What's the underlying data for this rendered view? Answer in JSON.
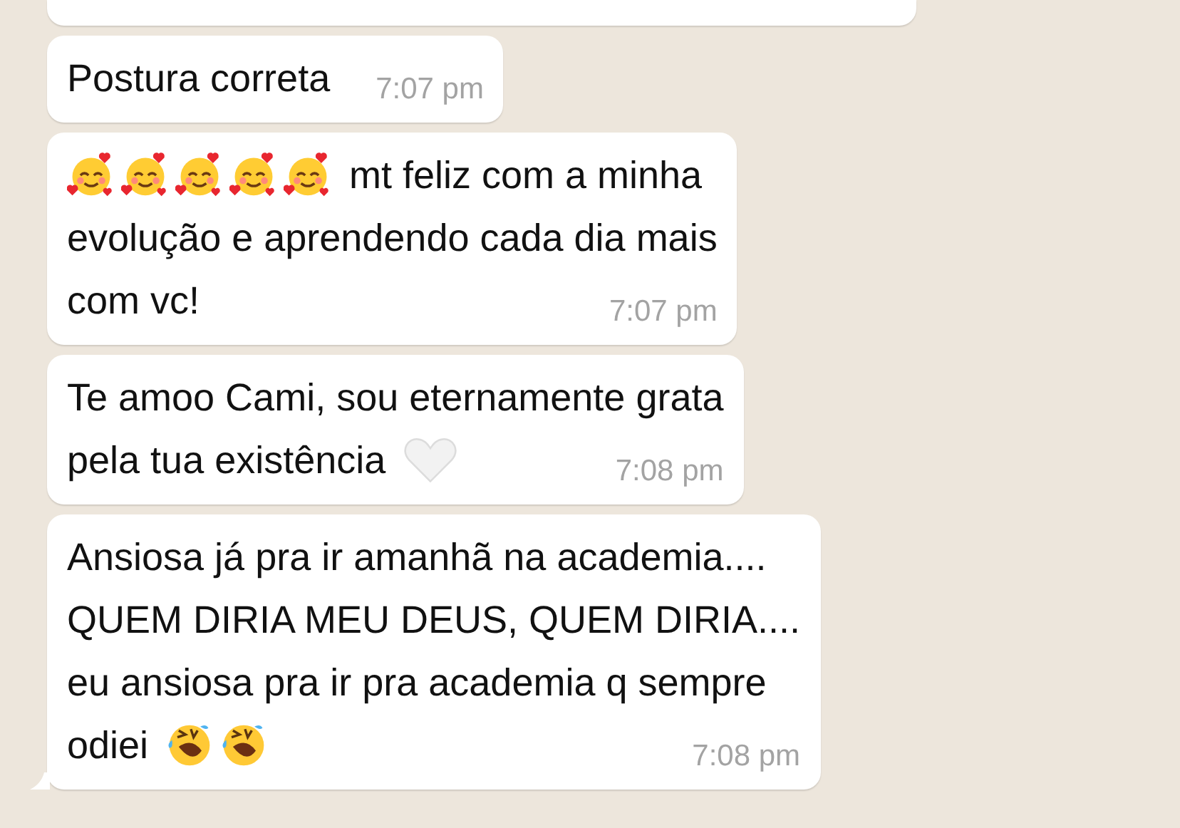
{
  "messages": [
    {
      "kind": "cut-off"
    },
    {
      "kind": "message",
      "tail": false,
      "time": "7:07 pm",
      "lines": [
        [
          {
            "kind": "text",
            "text": "Postura correta"
          }
        ]
      ]
    },
    {
      "kind": "message",
      "tail": false,
      "time": "7:07 pm",
      "lines": [
        [
          {
            "kind": "hearts-face"
          },
          {
            "kind": "hearts-face"
          },
          {
            "kind": "hearts-face"
          },
          {
            "kind": "hearts-face"
          },
          {
            "kind": "hearts-face"
          },
          {
            "kind": "text",
            "text": "mt feliz com a minha"
          }
        ],
        [
          {
            "kind": "text",
            "text": "evolução e aprendendo cada dia mais"
          }
        ],
        [
          {
            "kind": "text",
            "text": "com vc!"
          }
        ]
      ]
    },
    {
      "kind": "message",
      "tail": false,
      "time": "7:08 pm",
      "lines": [
        [
          {
            "kind": "text",
            "text": "Te amoo Cami, sou eternamente grata"
          }
        ],
        [
          {
            "kind": "text",
            "text": "pela tua existência"
          },
          {
            "kind": "white-heart"
          }
        ]
      ]
    },
    {
      "kind": "message",
      "tail": true,
      "time": "7:08 pm",
      "lines": [
        [
          {
            "kind": "text",
            "text": "Ansiosa já pra ir amanhã na academia...."
          }
        ],
        [
          {
            "kind": "text",
            "text": "QUEM DIRIA MEU DEUS, QUEM DIRIA...."
          }
        ],
        [
          {
            "kind": "text",
            "text": "eu ansiosa pra ir pra academia q sempre"
          }
        ],
        [
          {
            "kind": "text",
            "text": "odiei"
          },
          {
            "kind": "laughing-face"
          },
          {
            "kind": "laughing-face"
          }
        ]
      ]
    }
  ]
}
